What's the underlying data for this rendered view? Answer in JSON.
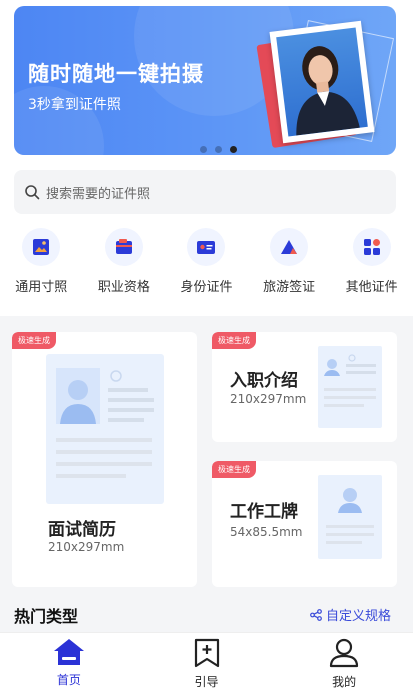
{
  "banner": {
    "title": "随时随地一键拍摄",
    "subtitle": "3秒拿到证件照",
    "dots_count": 3,
    "active_dot": 2
  },
  "search": {
    "placeholder": "搜索需要的证件照"
  },
  "categories": [
    {
      "label": "通用寸照",
      "icon": "photo-icon"
    },
    {
      "label": "职业资格",
      "icon": "folder-icon"
    },
    {
      "label": "身份证件",
      "icon": "id-card-icon"
    },
    {
      "label": "旅游签证",
      "icon": "travel-icon"
    },
    {
      "label": "其他证件",
      "icon": "grid-icon"
    }
  ],
  "tiles": {
    "resume": {
      "tag": "极速生成",
      "title": "面试简历",
      "size": "210x297mm"
    },
    "onboarding": {
      "tag": "极速生成",
      "title": "入职介绍",
      "size": "210x297mm"
    },
    "badge": {
      "tag": "极速生成",
      "title": "工作工牌",
      "size": "54x85.5mm"
    }
  },
  "hot": {
    "title": "热门类型",
    "custom_label": "自定义规格"
  },
  "tabbar": [
    {
      "label": "首页",
      "icon": "home-icon",
      "active": true
    },
    {
      "label": "引导",
      "icon": "bookmark-add-icon",
      "active": false
    },
    {
      "label": "我的",
      "icon": "user-icon",
      "active": false
    }
  ],
  "colors": {
    "accent": "#2b32d6",
    "tag": "#ef5a66",
    "banner": "#4d86f3"
  }
}
